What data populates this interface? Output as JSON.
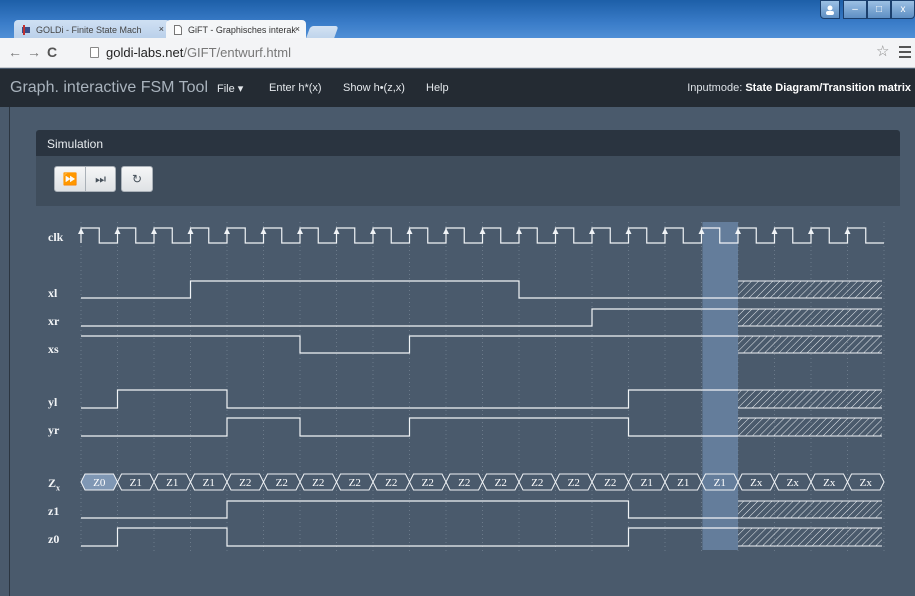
{
  "browser": {
    "tabs": [
      {
        "label": "GOLDi - Finite State Mach",
        "active": false
      },
      {
        "label": "GiFT - Graphisches interak",
        "active": true
      }
    ],
    "tab_close": "×",
    "url_host": "goldi-labs.net",
    "url_path": "/GIFT/entwurf.html",
    "window_buttons": {
      "min": "–",
      "max": "□",
      "close": "x"
    }
  },
  "app": {
    "brand": "Graph. interactive FSM Tool",
    "menu": {
      "file": "File ▾",
      "enter": "Enter h*(x)",
      "show": "Show h•(z,x)",
      "help": "Help"
    },
    "inputmode_label": "Inputmode:",
    "inputmode_value": "State Diagram/Transition matrix"
  },
  "simulation": {
    "title": "Simulation",
    "buttons": {
      "run": "⏩",
      "step": "⏭",
      "reset": "↻"
    },
    "highlighted_cycle": 17,
    "clock_cycles": 22,
    "signals": {
      "clk": {
        "label": "clk"
      },
      "inputs": [
        {
          "label": "xl",
          "values": [
            0,
            0,
            0,
            1,
            1,
            1,
            1,
            1,
            1,
            1,
            1,
            1,
            0,
            0,
            0,
            0,
            0,
            0
          ]
        },
        {
          "label": "xr",
          "values": [
            0,
            0,
            0,
            0,
            0,
            0,
            0,
            0,
            0,
            0,
            0,
            0,
            0,
            0,
            1,
            1,
            1,
            1
          ]
        },
        {
          "label": "xs",
          "values": [
            1,
            1,
            1,
            1,
            1,
            1,
            0,
            0,
            0,
            1,
            1,
            1,
            1,
            1,
            1,
            1,
            1,
            1
          ]
        }
      ],
      "outputs": [
        {
          "label": "yl",
          "values": [
            0,
            1,
            1,
            1,
            0,
            0,
            0,
            0,
            0,
            0,
            0,
            0,
            0,
            0,
            0,
            1,
            1,
            1
          ]
        },
        {
          "label": "yr",
          "values": [
            0,
            0,
            0,
            0,
            1,
            1,
            0,
            0,
            0,
            1,
            1,
            1,
            1,
            1,
            1,
            0,
            0,
            0
          ]
        }
      ],
      "state": {
        "label": "Z",
        "subscript": "x",
        "values": [
          "Z0",
          "Z1",
          "Z1",
          "Z1",
          "Z2",
          "Z2",
          "Z2",
          "Z2",
          "Z2",
          "Z2",
          "Z2",
          "Z2",
          "Z2",
          "Z2",
          "Z2",
          "Z1",
          "Z1",
          "Z1",
          "Zx",
          "Zx",
          "Zx",
          "Zx"
        ]
      },
      "state_bits": [
        {
          "label": "z1",
          "values": [
            0,
            0,
            0,
            0,
            1,
            1,
            1,
            1,
            1,
            1,
            1,
            1,
            1,
            1,
            1,
            0,
            0,
            0
          ]
        },
        {
          "label": "z0",
          "values": [
            0,
            1,
            1,
            1,
            0,
            0,
            0,
            0,
            0,
            0,
            0,
            0,
            0,
            0,
            0,
            1,
            1,
            1
          ]
        }
      ]
    }
  }
}
